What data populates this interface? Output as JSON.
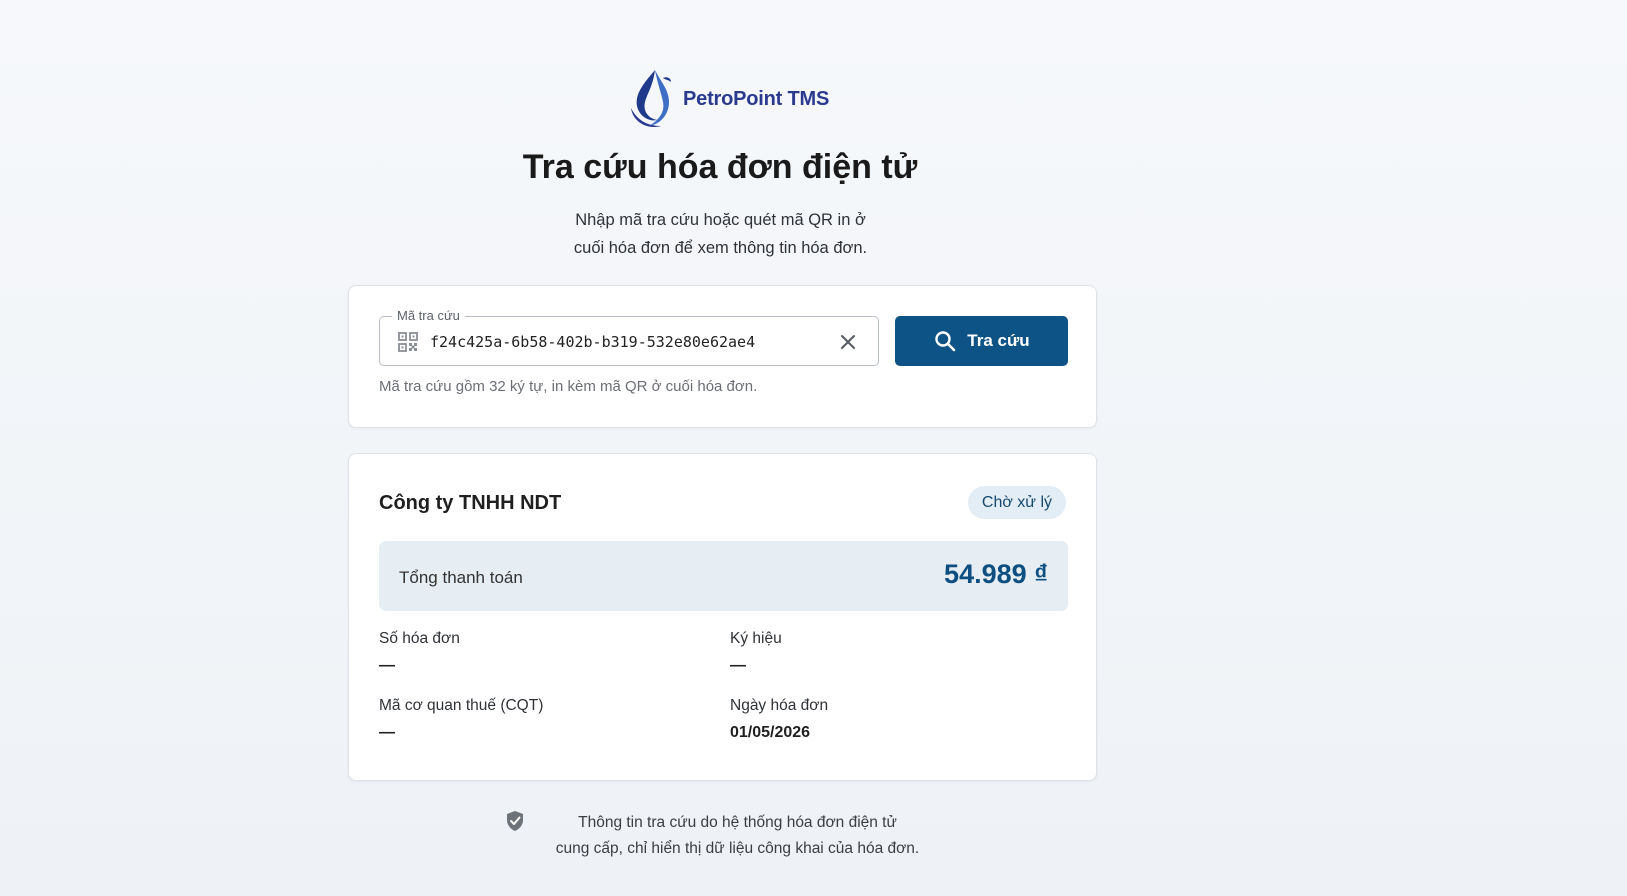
{
  "brand": {
    "name": "PetroPoint TMS",
    "logo_icon": "drop-swirl-logo"
  },
  "header": {
    "title": "Tra cứu hóa đơn điện tử",
    "subtitle_line1": "Nhập mã tra cứu hoặc quét mã QR in ở",
    "subtitle_line2": "cuối hóa đơn để xem thông tin hóa đơn."
  },
  "search": {
    "label": "Mã tra cứu",
    "value": "f24c425a-6b58-402b-b319-532e80e62ae4",
    "placeholder": "",
    "hint": "Mã tra cứu gồm 32 ký tự, in kèm mã QR ở cuối hóa đơn.",
    "button_label": "Tra cứu",
    "icons": {
      "leading": "qr-code-icon",
      "clear": "close-icon",
      "button": "search-icon"
    }
  },
  "result": {
    "company": "Công ty TNHH NDT",
    "status": "Chờ xử lý",
    "total_label": "Tổng thanh toán",
    "total_value": "54.989 ₫",
    "fields": {
      "invoice_number": {
        "label": "Số hóa đơn",
        "value": "—"
      },
      "symbol": {
        "label": "Ký hiệu",
        "value": "—"
      },
      "tax_code": {
        "label": "Mã cơ quan thuế (CQT)",
        "value": "—"
      },
      "invoice_date": {
        "label": "Ngày hóa đơn",
        "value": "01/05/2026"
      }
    }
  },
  "footer": {
    "note_line1": "Thông tin tra cứu do hệ thống hóa đơn điện tử",
    "note_line2": "cung cấp, chỉ hiển thị dữ liệu công khai của hóa đơn.",
    "icon": "shield-check-icon"
  },
  "colors": {
    "primary": "#0d5385",
    "total_text": "#0d4f80",
    "badge_bg": "#e3edf5",
    "total_bg": "#e6edf3",
    "brand_text": "#2b3a8f"
  }
}
